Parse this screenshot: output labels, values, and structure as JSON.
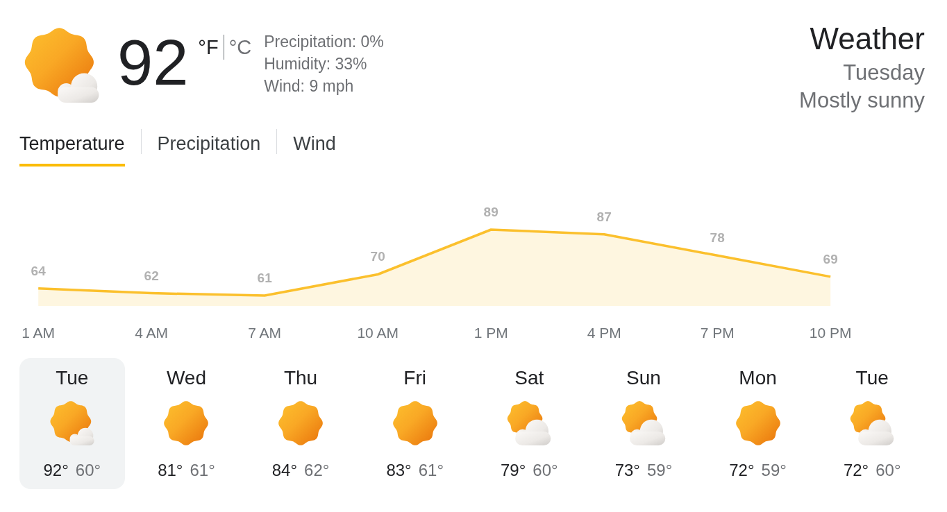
{
  "current": {
    "kind": "mostly_sunny",
    "temperature": "92",
    "units": [
      {
        "label": "°F",
        "selected": true
      },
      {
        "label": "°C",
        "selected": false
      }
    ],
    "details": [
      "Precipitation: 0%",
      "Humidity: 33%",
      "Wind: 9 mph"
    ]
  },
  "header": {
    "title": "Weather",
    "day": "Tuesday",
    "condition": "Mostly sunny"
  },
  "tabs": [
    {
      "label": "Temperature",
      "selected": true
    },
    {
      "label": "Precipitation",
      "selected": false
    },
    {
      "label": "Wind",
      "selected": false
    }
  ],
  "chart_data": {
    "type": "area",
    "categories": [
      "1 AM",
      "4 AM",
      "7 AM",
      "10 AM",
      "1 PM",
      "4 PM",
      "7 PM",
      "10 PM"
    ],
    "series": [
      {
        "color": "#fbc02d",
        "values": [
          64,
          62,
          61,
          70,
          89,
          87,
          78,
          69
        ]
      }
    ],
    "data_labels": true
  },
  "days": [
    {
      "name": "Tue",
      "kind": "mostly_sunny",
      "high": "92°",
      "low": "60°",
      "selected": true
    },
    {
      "name": "Wed",
      "kind": "sunny",
      "high": "81°",
      "low": "61°",
      "selected": false
    },
    {
      "name": "Thu",
      "kind": "sunny",
      "high": "84°",
      "low": "62°",
      "selected": false
    },
    {
      "name": "Fri",
      "kind": "sunny",
      "high": "83°",
      "low": "61°",
      "selected": false
    },
    {
      "name": "Sat",
      "kind": "partly_cloudy",
      "high": "79°",
      "low": "60°",
      "selected": false
    },
    {
      "name": "Sun",
      "kind": "partly_cloudy",
      "high": "73°",
      "low": "59°",
      "selected": false
    },
    {
      "name": "Mon",
      "kind": "sunny",
      "high": "72°",
      "low": "59°",
      "selected": false
    },
    {
      "name": "Tue",
      "kind": "partly_cloudy",
      "high": "72°",
      "low": "60°",
      "selected": false
    }
  ]
}
